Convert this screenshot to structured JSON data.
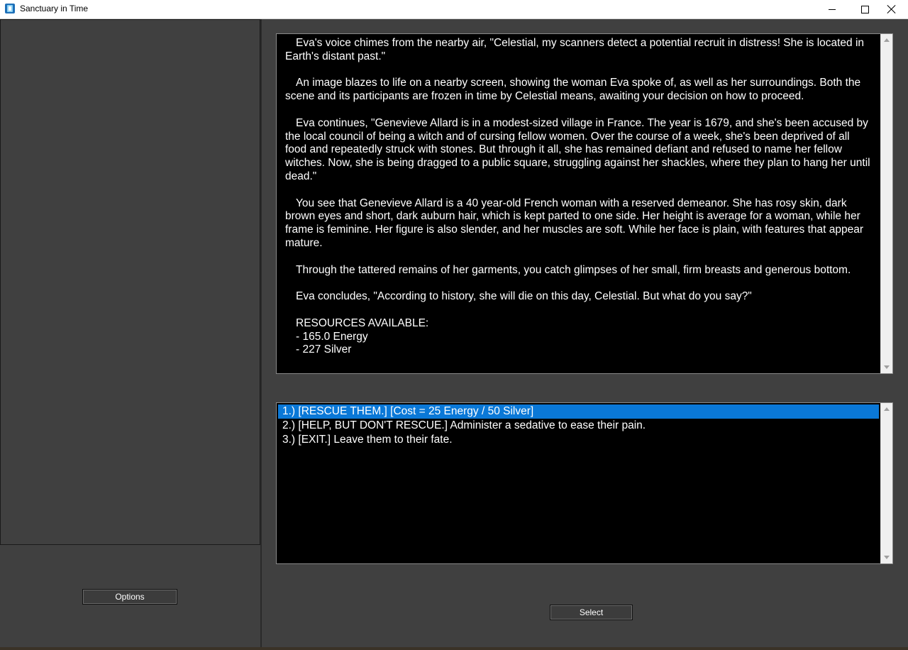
{
  "window": {
    "title": "Sanctuary in Time",
    "icon": "app-icon"
  },
  "sidebar": {
    "options_label": "Options"
  },
  "story": {
    "paragraphs": [
      "Eva's voice chimes from the nearby air, \"Celestial, my scanners detect a potential recruit in distress! She is located in Earth's distant past.\"",
      "An image blazes to life on a nearby screen, showing the woman Eva spoke of, as well as her surroundings. Both the scene and its participants are frozen in time by Celestial means, awaiting your decision on how to proceed.",
      "Eva continues, \"Genevieve Allard is in a modest-sized village in France. The year is 1679, and she's been accused by the local council of being a witch and of cursing fellow women. Over the course of a week, she's been deprived of all food and repeatedly struck with stones. But through it all, she has remained defiant and refused to name her fellow witches. Now, she is being dragged to a public square, struggling against her shackles, where they plan to hang her until dead.\"",
      "You see that Genevieve Allard is a 40 year-old French woman with a reserved demeanor. She has rosy skin, dark brown eyes and short, dark auburn hair, which is kept parted to one side. Her height is average for a woman, while her frame is feminine. Her figure is also slender, and her muscles are soft. While her face is plain, with features that appear mature.",
      "Through the tattered remains of her garments, you catch glimpses of her small, firm breasts and generous bottom.",
      "Eva concludes, \"According to history, she will die on this day, Celestial. But what do you say?\""
    ],
    "resources_header": "RESOURCES AVAILABLE:",
    "resources": [
      "- 165.0 Energy",
      "- 227 Silver"
    ]
  },
  "choices": {
    "items": [
      "1.) [RESCUE THEM.] [Cost = 25 Energy / 50 Silver]",
      "2.) [HELP, BUT DON'T RESCUE.] Administer a sedative to ease their pain.",
      "3.) [EXIT.] Leave them to their fate."
    ],
    "selected_index": 0
  },
  "actions": {
    "select_label": "Select"
  },
  "colors": {
    "background": "#404040",
    "panel": "#000000",
    "selection": "#0a78d7",
    "text": "#ffffff"
  }
}
